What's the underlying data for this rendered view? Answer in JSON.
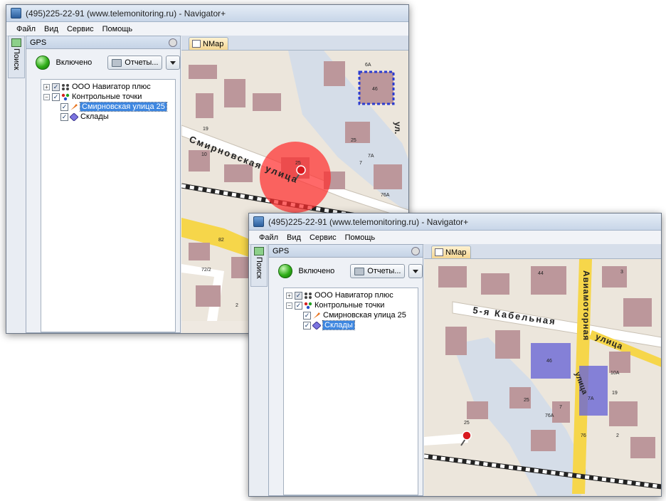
{
  "window_title": "(495)225-22-91  (www.telemonitoring.ru) - Navigator+",
  "menu": [
    "Файл",
    "Вид",
    "Сервис",
    "Помощь"
  ],
  "side_tab_label": "Поиск",
  "panel_title": "GPS",
  "status_label": "Включено",
  "reports_button": "Отчеты...",
  "map_tab": "NMap",
  "tree": {
    "company": "ООО Навигатор плюс",
    "checkpoints": "Контрольные точки",
    "point1": "Смирновская улица 25",
    "point2": "Склады"
  },
  "map_labels": {
    "street_smirnovskaya": "Смирновская  улица",
    "street_kabelnaya": "5-я  Кабельная",
    "street_aviamotornaya": "Авиамоторная",
    "street_ulitsa": "улица",
    "street_ul": "ул.",
    "houses_top": [
      "6А",
      "46",
      "25",
      "19",
      "10",
      "25",
      "7А",
      "7",
      "76А",
      "72/2",
      "82",
      "2"
    ],
    "houses_bottom": [
      "44",
      "46",
      "10А",
      "25",
      "76А",
      "19",
      "25",
      "7А",
      "7",
      "76",
      "2",
      "3"
    ]
  },
  "colors": {
    "accent_selection": "#3d86e0",
    "status_green": "#2fae18",
    "map_buildings": "#bc979b",
    "map_roads_yellow": "#f6d64a",
    "map_water": "#d6dee8",
    "geofence_circle": "#ff3030",
    "warehouse_fill": "#6a66d6"
  },
  "icons": [
    "app-icon",
    "search-tab-icon",
    "pin-icon",
    "status-led",
    "printer-icon",
    "dropdown-arrow-icon",
    "company-icon",
    "checkpoints-icon",
    "point-marker-icon",
    "warehouse-icon",
    "map-tab-icon",
    "mouse-cursor-icon",
    "map-pin-icon"
  ]
}
